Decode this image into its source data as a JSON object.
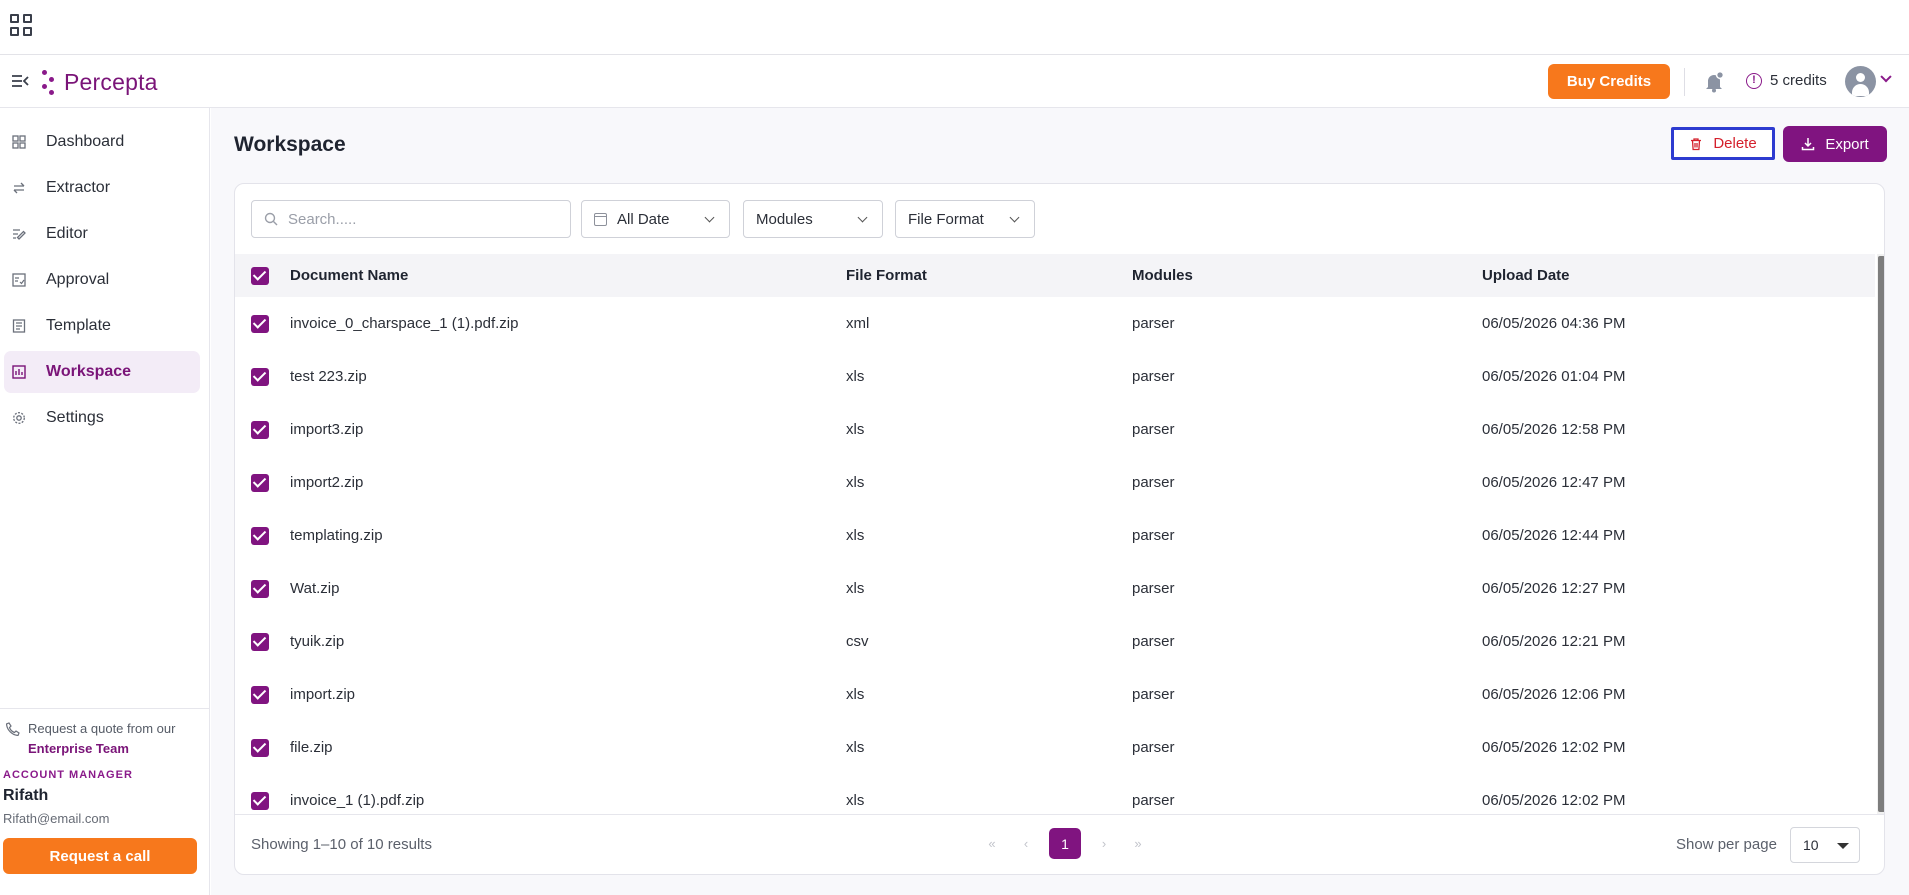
{
  "app": {
    "name": "Percepta"
  },
  "header": {
    "buy_credits_label": "Buy Credits",
    "credits_label": "5 credits",
    "info_glyph": "!"
  },
  "sidebar": {
    "items": [
      {
        "label": "Dashboard",
        "icon": "dashboard-icon"
      },
      {
        "label": "Extractor",
        "icon": "arrows-icon"
      },
      {
        "label": "Editor",
        "icon": "edit-icon"
      },
      {
        "label": "Approval",
        "icon": "approval-icon"
      },
      {
        "label": "Template",
        "icon": "template-icon"
      },
      {
        "label": "Workspace",
        "icon": "workspace-icon",
        "active": true
      },
      {
        "label": "Settings",
        "icon": "gear-icon"
      }
    ],
    "quote_text": "Request a quote from our",
    "quote_team": "Enterprise Team",
    "account_label": "ACCOUNT MANAGER",
    "account_name": "Rifath",
    "account_email": "Rifath@email.com",
    "call_label": "Request a call"
  },
  "main": {
    "title": "Workspace",
    "delete_label": "Delete",
    "export_label": "Export",
    "search_placeholder": "Search.....",
    "filters": {
      "date": "All Date",
      "modules": "Modules",
      "format": "File Format"
    },
    "columns": {
      "name": "Document Name",
      "format": "File Format",
      "modules": "Modules",
      "date": "Upload Date"
    },
    "rows": [
      {
        "name": "invoice_0_charspace_1 (1).pdf.zip",
        "format": "xml",
        "module": "parser",
        "date": "06/05/2026 04:36 PM"
      },
      {
        "name": "test 223.zip",
        "format": "xls",
        "module": "parser",
        "date": "06/05/2026 01:04 PM"
      },
      {
        "name": "import3.zip",
        "format": "xls",
        "module": "parser",
        "date": "06/05/2026 12:58 PM"
      },
      {
        "name": "import2.zip",
        "format": "xls",
        "module": "parser",
        "date": "06/05/2026 12:47 PM"
      },
      {
        "name": "templating.zip",
        "format": "xls",
        "module": "parser",
        "date": "06/05/2026 12:44 PM"
      },
      {
        "name": "Wat.zip",
        "format": "xls",
        "module": "parser",
        "date": "06/05/2026 12:27 PM"
      },
      {
        "name": "tyuik.zip",
        "format": "csv",
        "module": "parser",
        "date": "06/05/2026 12:21 PM"
      },
      {
        "name": "import.zip",
        "format": "xls",
        "module": "parser",
        "date": "06/05/2026 12:06 PM"
      },
      {
        "name": "file.zip",
        "format": "xls",
        "module": "parser",
        "date": "06/05/2026 12:02 PM"
      },
      {
        "name": "invoice_1 (1).pdf.zip",
        "format": "xls",
        "module": "parser",
        "date": "06/05/2026 12:02 PM"
      }
    ],
    "footer": {
      "showing": "Showing 1–10 of 10 results",
      "current_page": "1",
      "per_page_label": "Show per page",
      "per_page_value": "10",
      "pager_glyphs": {
        "first": "«",
        "prev": "‹",
        "next": "›",
        "last": "»"
      }
    }
  },
  "colors": {
    "brand": "#801480",
    "accent": "#f7781c",
    "danger": "#d4202c",
    "focus": "#2d3bd0"
  }
}
